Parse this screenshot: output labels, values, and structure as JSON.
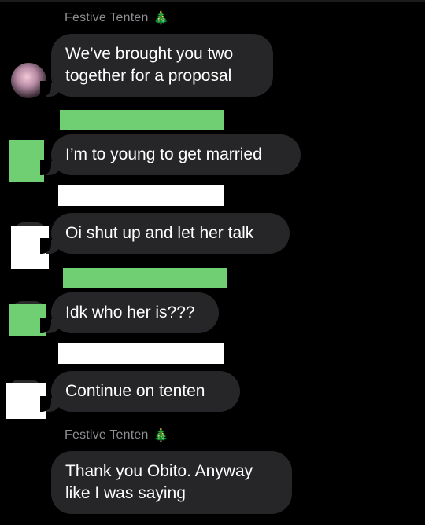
{
  "thread": {
    "sender_top": "Festive Tenten",
    "sender_bottom": "Festive Tenten",
    "sender_emoji": "🎄",
    "messages": [
      {
        "text": "We’ve brought you two\ntogether for a proposal"
      },
      {
        "text": "I’m to young to get married"
      },
      {
        "text": "Oi shut up and let her talk"
      },
      {
        "text": "Idk who her is???"
      },
      {
        "text": "Continue on tenten"
      },
      {
        "text": "Thank you Obito. Anyway\nlike I was saying"
      }
    ]
  },
  "colors": {
    "background": "#000000",
    "bubble": "#262628",
    "sender_name": "#8e8e93",
    "redaction_green": "#6fcf72",
    "redaction_white": "#ffffff"
  }
}
